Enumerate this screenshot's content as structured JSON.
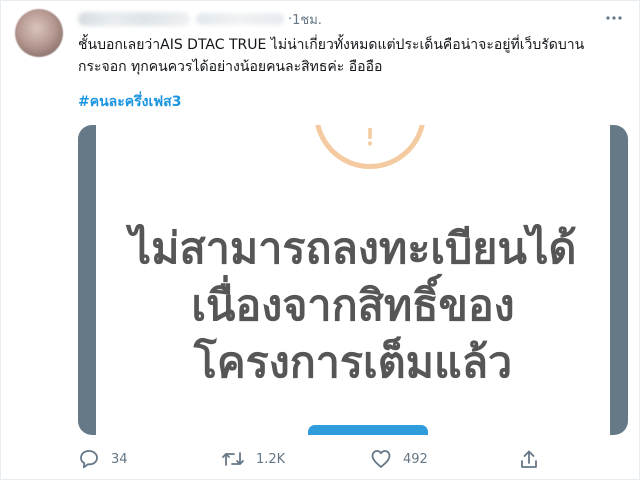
{
  "tweet": {
    "time": "1ชม.",
    "separator": "·",
    "text": "ชั้นบอกเลยว่าAIS DTAC TRUE ไม่น่าเกี่ยวทั้งหมดแต่ประเด็นคือน่าจะอยู่ที่เว็บรัดบานกระจอก ทุกคนควรได้อย่างน้อยคนละสิทธค่ะ อืออือ",
    "hashtag": "#คนละครึ่งเฟส3",
    "media": {
      "message_line1": "ไม่สามารถลงทะเบียนได้",
      "message_line2": "เนื่องจากสิทธิ์ของ",
      "message_line3": "โครงการเต็มแล้ว",
      "accent_color": "#f4cba1",
      "button_color": "#2f9ddb"
    },
    "actions": {
      "reply_count": "34",
      "retweet_count": "1.2K",
      "like_count": "492"
    }
  },
  "icons": {
    "more": "more-icon",
    "reply": "reply-icon",
    "retweet": "retweet-icon",
    "like": "heart-icon",
    "share": "share-icon",
    "alert": "alert-icon"
  }
}
